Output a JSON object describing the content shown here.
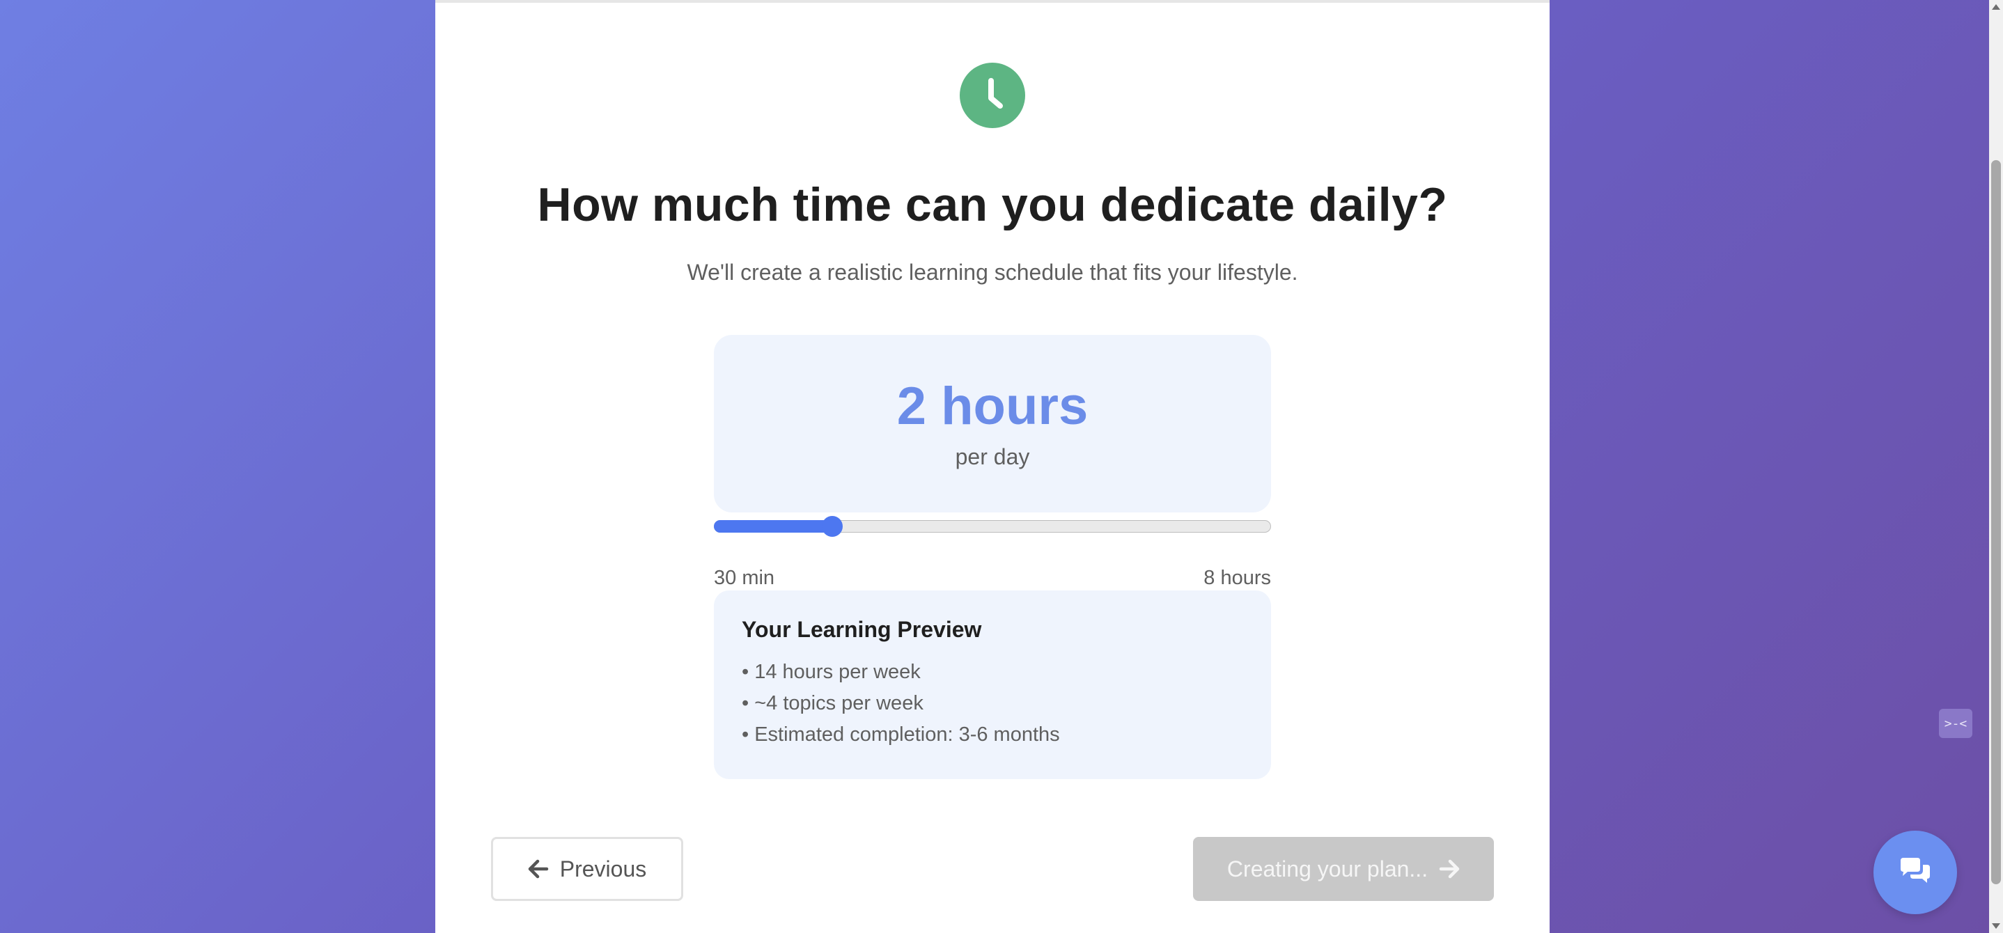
{
  "question": {
    "title": "How much time can you dedicate daily?",
    "subtitle": "We'll create a realistic learning schedule that fits your lifestyle."
  },
  "selection": {
    "value": "2 hours",
    "unit": "per day"
  },
  "slider": {
    "min_label": "30 min",
    "max_label": "8 hours",
    "min_minutes": 30,
    "max_minutes": 480,
    "current_minutes": 120,
    "accent_color": "#4d77f0"
  },
  "preview": {
    "title": "Your Learning Preview",
    "items": [
      "• 14 hours per week",
      "• ~4 topics per week",
      "• Estimated completion: 3-6 months"
    ]
  },
  "navigation": {
    "previous_label": "Previous",
    "next_label": "Creating your plan...",
    "next_disabled": true
  },
  "icons": {
    "header": "clock-icon",
    "previous": "arrow-left-icon",
    "next": "arrow-right-icon",
    "chat": "chat-bubbles-icon",
    "side_widget": "collapse-icon"
  },
  "side_widget": {
    "text": ">-<"
  },
  "colors": {
    "clock": "#5db583",
    "value": "#6b8ce8",
    "chat_button": "#6b8ff0",
    "next_button_disabled": "#c8c8c8"
  }
}
